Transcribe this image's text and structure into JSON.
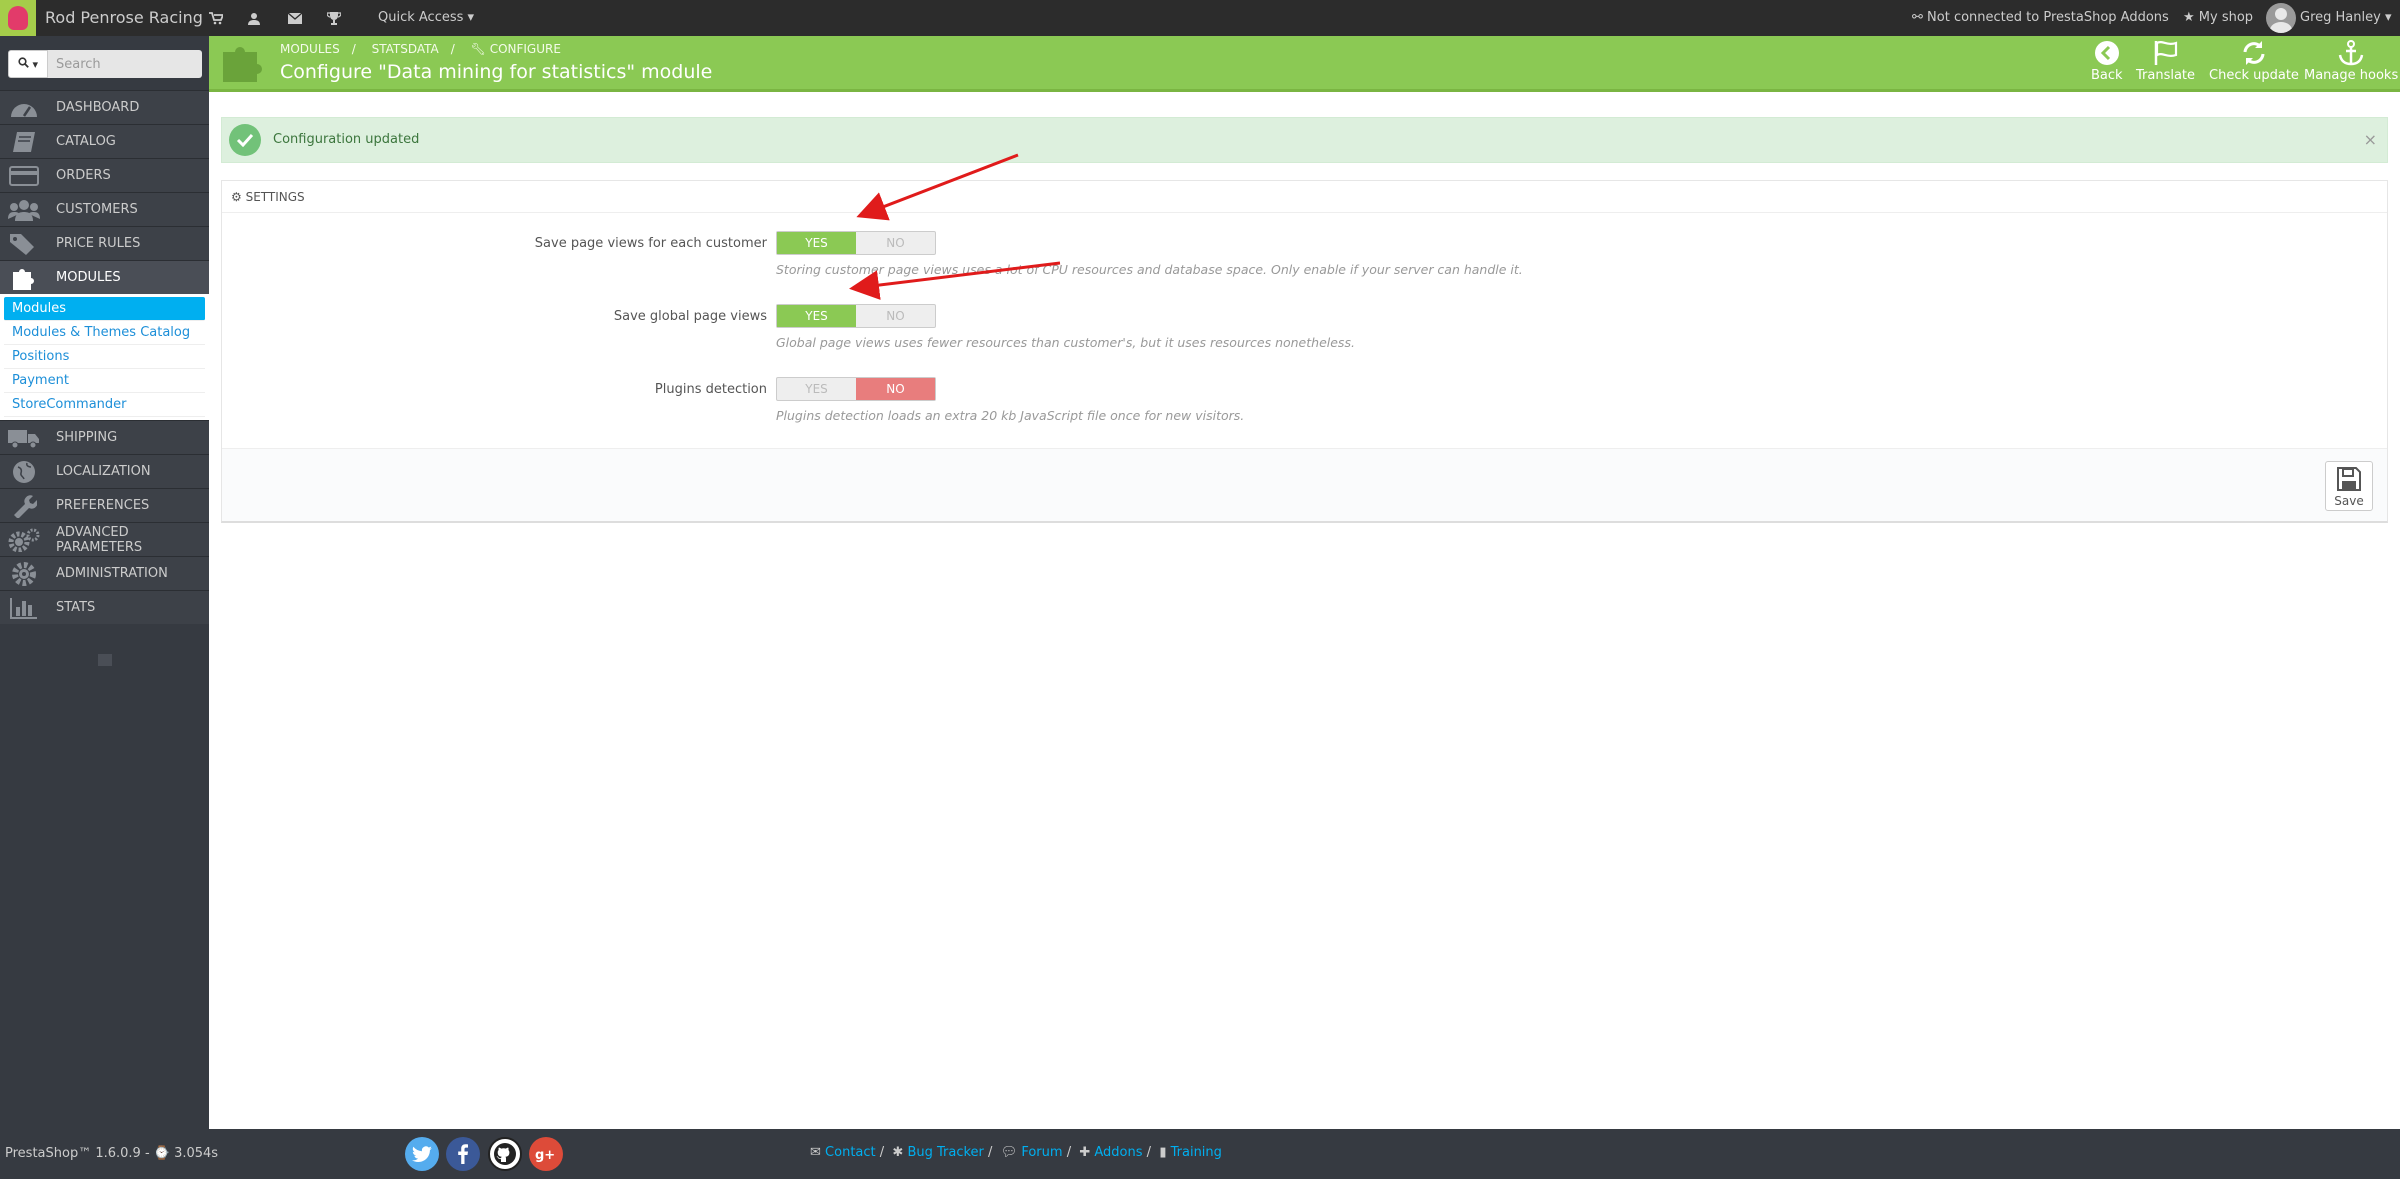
{
  "topbar": {
    "shop_name": "Rod Penrose Racing",
    "icons": [
      "cart-icon",
      "user-icon",
      "envelope-icon",
      "trophy-icon"
    ],
    "quick_access": "Quick Access",
    "addons_status": "Not connected to PrestaShop Addons",
    "my_shop": "My shop",
    "user_name": "Greg Hanley"
  },
  "sidebar": {
    "search_placeholder": "Search",
    "items": [
      {
        "label": "DASHBOARD",
        "icon": "dashboard-icon"
      },
      {
        "label": "CATALOG",
        "icon": "book-icon"
      },
      {
        "label": "ORDERS",
        "icon": "credit-card-icon"
      },
      {
        "label": "CUSTOMERS",
        "icon": "users-icon"
      },
      {
        "label": "PRICE RULES",
        "icon": "tags-icon"
      },
      {
        "label": "MODULES",
        "icon": "puzzle-icon"
      },
      {
        "label": "SHIPPING",
        "icon": "truck-icon"
      },
      {
        "label": "LOCALIZATION",
        "icon": "globe-icon"
      },
      {
        "label": "PREFERENCES",
        "icon": "wrench-icon"
      },
      {
        "label": "ADVANCED PARAMETERS",
        "icon": "cogs-icon"
      },
      {
        "label": "ADMINISTRATION",
        "icon": "cog-icon"
      },
      {
        "label": "STATS",
        "icon": "bar-chart-icon"
      }
    ],
    "modules_sub": [
      "Modules",
      "Modules & Themes Catalog",
      "Positions",
      "Payment",
      "StoreCommander"
    ]
  },
  "header": {
    "breadcrumb": [
      "MODULES",
      "STATSDATA",
      "CONFIGURE"
    ],
    "title": "Configure \"Data mining for statistics\" module",
    "toolbar": [
      {
        "label": "Back",
        "icon": "arrow-left-circle-icon"
      },
      {
        "label": "Translate",
        "icon": "flag-icon"
      },
      {
        "label": "Check update",
        "icon": "refresh-icon"
      },
      {
        "label": "Manage hooks",
        "icon": "anchor-icon"
      }
    ]
  },
  "alert": {
    "text": "Configuration updated",
    "close": "×"
  },
  "settings": {
    "title": "SETTINGS",
    "rows": [
      {
        "label": "Save page views for each customer",
        "value": "YES",
        "help": "Storing customer page views uses a lot of CPU resources and database space. Only enable if your server can handle it."
      },
      {
        "label": "Save global page views",
        "value": "YES",
        "help": "Global page views uses fewer resources than customer's, but it uses resources nonetheless."
      },
      {
        "label": "Plugins detection",
        "value": "NO",
        "help": "Plugins detection loads an extra 20 kb JavaScript file once for new visitors."
      }
    ],
    "yes": "YES",
    "no": "NO",
    "save": "Save"
  },
  "footer": {
    "version": "PrestaShop™ 1.6.0.9 - ⌚ 3.054s",
    "links": [
      "Contact",
      "Bug Tracker",
      "Forum",
      "Addons",
      "Training"
    ],
    "social": [
      "twitter-icon",
      "facebook-icon",
      "github-icon",
      "google-plus-icon"
    ],
    "colors": {
      "twitter": "#55acee",
      "facebook": "#3b5998",
      "github": "#222222",
      "google_plus": "#dd4b39"
    }
  }
}
